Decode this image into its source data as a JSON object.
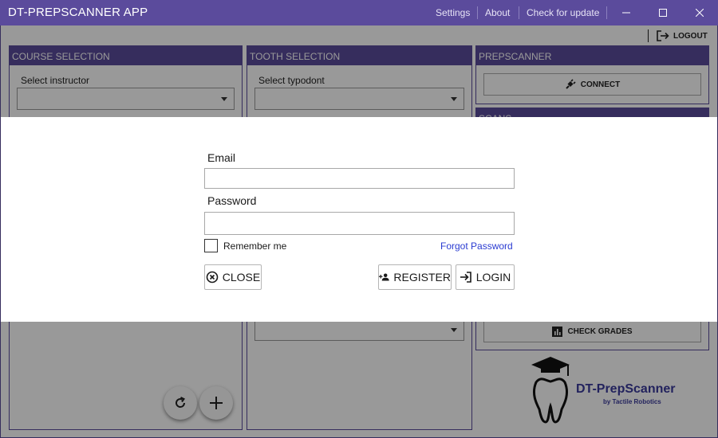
{
  "window": {
    "title": "DT-PREPSCANNER APP",
    "menu": [
      "Settings",
      "About",
      "Check for update"
    ]
  },
  "header": {
    "logout_label": "LOGOUT"
  },
  "course_panel": {
    "title": "COURSE SELECTION",
    "instructor_label": "Select instructor",
    "instructor_value": ""
  },
  "tooth_panel": {
    "title": "TOOTH SELECTION",
    "typodont_label": "Select typodont",
    "typodont_value": "",
    "second_value": ""
  },
  "scanner_panel": {
    "title": "PREPSCANNER",
    "connect_label": "CONNECT",
    "scans_title": "SCANS",
    "check_grades_label": "CHECK GRADES"
  },
  "logo": {
    "name": "DT-PrepScanner",
    "tagline": "by Tactile Robotics"
  },
  "login_dialog": {
    "email_label": "Email",
    "email_value": "",
    "password_label": "Password",
    "password_value": "",
    "remember_label": "Remember me",
    "remember_checked": false,
    "forgot_label": "Forgot Password",
    "close_label": "CLOSE",
    "register_label": "REGISTER",
    "login_label": "LOGIN"
  },
  "colors": {
    "accent": "#5b4b9c",
    "link": "#2a3bd1",
    "overlay": "rgba(0,0,0,0.40)"
  }
}
